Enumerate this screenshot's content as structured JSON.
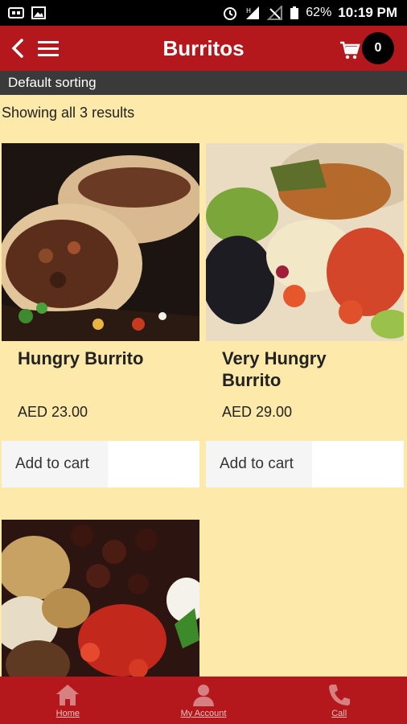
{
  "status_bar": {
    "battery": "62%",
    "time": "10:19 PM",
    "icons": [
      "sim-icon",
      "image-icon",
      "alarm-icon",
      "signal-h-icon",
      "no-signal-icon",
      "battery-icon"
    ]
  },
  "app_bar": {
    "title": "Burritos",
    "cart_count": "0",
    "icons": [
      "back-arrow-icon",
      "hamburger-menu-icon",
      "cart-icon"
    ]
  },
  "sort": {
    "label": "Default sorting"
  },
  "results_text": "Showing all 3 results",
  "products": [
    {
      "name": "Hungry Burrito",
      "price": "AED 23.00",
      "button": "Add to cart"
    },
    {
      "name": "Very Hungry Burrito",
      "price": "AED 29.00",
      "button": "Add to cart"
    },
    {
      "name": "",
      "price": "",
      "button": ""
    }
  ],
  "bottom_nav": {
    "items": [
      {
        "label": "Home",
        "icon": "home-icon"
      },
      {
        "label": "My Account",
        "icon": "account-icon"
      },
      {
        "label": "Call",
        "icon": "phone-icon"
      }
    ]
  },
  "colors": {
    "brand_red": "#b5181c",
    "page_background": "#fde9a9",
    "sort_bar": "#3a3a3a"
  }
}
